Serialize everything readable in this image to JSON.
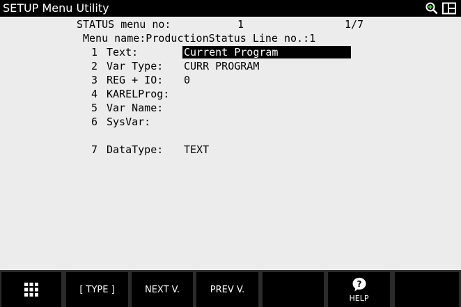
{
  "titlebar": {
    "title": "SETUP Menu Utility"
  },
  "header": {
    "status_label": "STATUS menu no:",
    "menu_no": "1",
    "page": "1/7",
    "menu_name": "Menu name:ProductionStatus Line no.:1"
  },
  "items": [
    {
      "num": "1",
      "label": "Text:",
      "value": "Current Program",
      "selected": true
    },
    {
      "num": "2",
      "label": "Var Type:",
      "value": "CURR PROGRAM"
    },
    {
      "num": "3",
      "label": "REG + IO:",
      "value": "0"
    },
    {
      "num": "4",
      "label": "KARELProg:",
      "value": ""
    },
    {
      "num": "5",
      "label": "Var Name:",
      "value": ""
    },
    {
      "num": "6",
      "label": "SysVar:",
      "value": ""
    },
    {
      "num": "7",
      "label": "DataType:",
      "value": "TEXT"
    }
  ],
  "fkeys": {
    "f0_icon": "menu-grid-icon",
    "f1": "[ TYPE ]",
    "f2": "NEXT V.",
    "f3": "PREV V.",
    "f4": "",
    "f5_label": "HELP",
    "f5_icon": "help-icon",
    "f6": ""
  }
}
